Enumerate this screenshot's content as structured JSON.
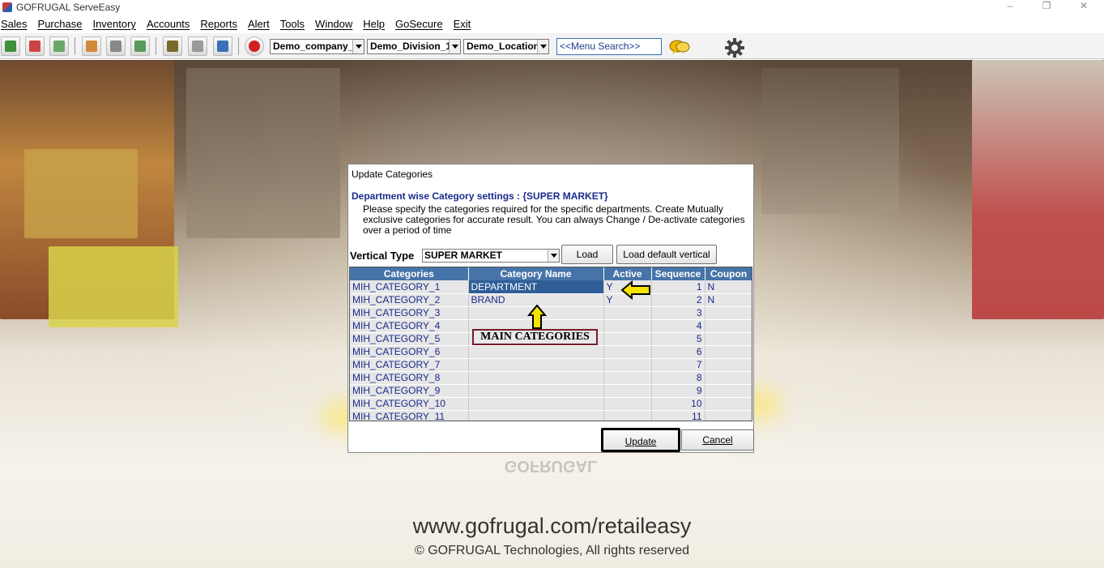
{
  "window": {
    "title": "GOFRUGAL ServeEasy",
    "controls": [
      "–",
      "❐",
      "✕"
    ]
  },
  "menu": [
    "Sales",
    "Purchase",
    "Inventory",
    "Accounts",
    "Reports",
    "Alert",
    "Tools",
    "Window",
    "Help",
    "GoSecure",
    "Exit"
  ],
  "toolbar": {
    "icons": [
      "sales-icon",
      "purchase-icon",
      "receipt-icon",
      "users-icon",
      "print-icon",
      "transfer-icon",
      "inventory-icon",
      "tools-icon",
      "report-chart-icon",
      "power-icon"
    ],
    "company": "Demo_company_",
    "division": "Demo_Division_1",
    "location": "Demo_Location",
    "menu_search_placeholder": "<<Menu Search>>",
    "chat_icon": "chat-bubbles-icon",
    "settings_icon": "gear-icon"
  },
  "background": {
    "url": "www.gofrugal.com/retaileasy",
    "copyright": "© GOFRUGAL Technologies, All rights reserved",
    "watermark": "GOFRUGAL"
  },
  "dialog": {
    "title": "Update Categories",
    "heading": "Department wise Category settings : {SUPER MARKET}",
    "description": "Please specify the categories required for the specific departments. Create Mutually exclusive categories  for accurate result. You can always Change / De-activate categories over a period of time",
    "vertical_type_label": "Vertical Type",
    "vertical_type_value": "SUPER MARKET",
    "load_label": "Load",
    "load_default_label": "Load default vertical",
    "columns": [
      "Categories",
      "Category Name",
      "Active",
      "Sequence",
      "Coupon"
    ],
    "rows": [
      {
        "category": "MIH_CATEGORY_1",
        "name": "DEPARTMENT",
        "active": "Y",
        "sequence": "1",
        "coupon": "N"
      },
      {
        "category": "MIH_CATEGORY_2",
        "name": "BRAND",
        "active": "Y",
        "sequence": "2",
        "coupon": "N"
      },
      {
        "category": "MIH_CATEGORY_3",
        "name": "",
        "active": "",
        "sequence": "3",
        "coupon": ""
      },
      {
        "category": "MIH_CATEGORY_4",
        "name": "",
        "active": "",
        "sequence": "4",
        "coupon": ""
      },
      {
        "category": "MIH_CATEGORY_5",
        "name": "",
        "active": "",
        "sequence": "5",
        "coupon": ""
      },
      {
        "category": "MIH_CATEGORY_6",
        "name": "",
        "active": "",
        "sequence": "6",
        "coupon": ""
      },
      {
        "category": "MIH_CATEGORY_7",
        "name": "",
        "active": "",
        "sequence": "7",
        "coupon": ""
      },
      {
        "category": "MIH_CATEGORY_8",
        "name": "",
        "active": "",
        "sequence": "8",
        "coupon": ""
      },
      {
        "category": "MIH_CATEGORY_9",
        "name": "",
        "active": "",
        "sequence": "9",
        "coupon": ""
      },
      {
        "category": "MIH_CATEGORY_10",
        "name": "",
        "active": "",
        "sequence": "10",
        "coupon": ""
      },
      {
        "category": "MIH_CATEGORY_11",
        "name": "",
        "active": "",
        "sequence": "11",
        "coupon": ""
      }
    ],
    "annotation_label": "MAIN CATEGORIES",
    "update_label": "Update",
    "cancel_label": "Cancel"
  },
  "colors": {
    "grid_header": "#4774a8",
    "grid_text": "#1a2a8c",
    "selected_cell": "#2f5e96",
    "annotation_arrow": "#f5e400"
  }
}
